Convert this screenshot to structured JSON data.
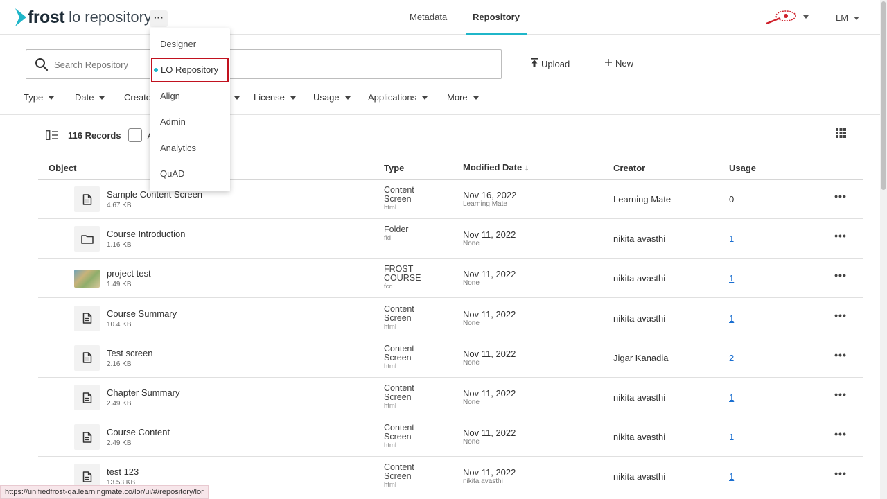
{
  "header": {
    "logo_text": "frost",
    "product_text": "lo repository",
    "app_switcher_label": "···",
    "tabs": [
      {
        "label": "Metadata"
      },
      {
        "label": "Repository",
        "active": true
      }
    ],
    "user_initials": "LM",
    "accent_color": "#1fb6c9"
  },
  "app_menu": {
    "items": [
      {
        "label": "Designer"
      },
      {
        "label": "LO Repository",
        "selected": true
      },
      {
        "label": "Align"
      },
      {
        "label": "Admin"
      },
      {
        "label": "Analytics"
      },
      {
        "label": "QuAD"
      }
    ]
  },
  "search": {
    "placeholder": "Search Repository",
    "value": ""
  },
  "actions": {
    "upload_label": "Upload",
    "new_label": "New"
  },
  "filters": [
    "Type",
    "Date",
    "Creato",
    "License",
    "Usage",
    "Applications",
    "More"
  ],
  "records": {
    "count_label": "116 Records",
    "select_all_label": "A"
  },
  "table": {
    "columns": {
      "object": "Object",
      "type": "Type",
      "modified": "Modified Date ↓",
      "creator": "Creator",
      "usage": "Usage"
    },
    "rows": [
      {
        "name": "Sample Content Screen",
        "size": "4.67 KB",
        "type": "Content Screen",
        "ext": "html",
        "date": "Nov 16, 2022",
        "modified_by": "Learning Mate",
        "creator": "Learning Mate",
        "usage": "0",
        "usage_link": false,
        "icon": "document-icon"
      },
      {
        "name": "Course Introduction",
        "size": "1.16 KB",
        "type": "Folder",
        "ext": "fld",
        "date": "Nov 11, 2022",
        "modified_by": "None",
        "creator": "nikita avasthi",
        "usage": "1",
        "usage_link": true,
        "icon": "folder-icon"
      },
      {
        "name": "project test",
        "size": "1.49 KB",
        "type": "FROST COURSE",
        "ext": "fcd",
        "date": "Nov 11, 2022",
        "modified_by": "None",
        "creator": "nikita avasthi",
        "usage": "1",
        "usage_link": true,
        "icon": "thumbnail-image"
      },
      {
        "name": "Course Summary",
        "size": "10.4 KB",
        "type": "Content Screen",
        "ext": "html",
        "date": "Nov 11, 2022",
        "modified_by": "None",
        "creator": "nikita avasthi",
        "usage": "1",
        "usage_link": true,
        "icon": "document-icon"
      },
      {
        "name": "Test screen",
        "size": "2.16 KB",
        "type": "Content Screen",
        "ext": "html",
        "date": "Nov 11, 2022",
        "modified_by": "None",
        "creator": "Jigar Kanadia",
        "usage": "2",
        "usage_link": true,
        "icon": "document-icon"
      },
      {
        "name": "Chapter Summary",
        "size": "2.49 KB",
        "type": "Content Screen",
        "ext": "html",
        "date": "Nov 11, 2022",
        "modified_by": "None",
        "creator": "nikita avasthi",
        "usage": "1",
        "usage_link": true,
        "icon": "document-icon"
      },
      {
        "name": "Course Content",
        "size": "2.49 KB",
        "type": "Content Screen",
        "ext": "html",
        "date": "Nov 11, 2022",
        "modified_by": "None",
        "creator": "nikita avasthi",
        "usage": "1",
        "usage_link": true,
        "icon": "document-icon"
      },
      {
        "name": "test 123",
        "size": "13.53 KB",
        "type": "Content Screen",
        "ext": "html",
        "date": "Nov 11, 2022",
        "modified_by": "nikita avasthi",
        "creator": "nikita avasthi",
        "usage": "1",
        "usage_link": true,
        "icon": "document-icon"
      }
    ]
  },
  "status_bar": {
    "url": "https://unifiedfrost-qa.learningmate.co/lor/ui/#/repository/lor"
  }
}
